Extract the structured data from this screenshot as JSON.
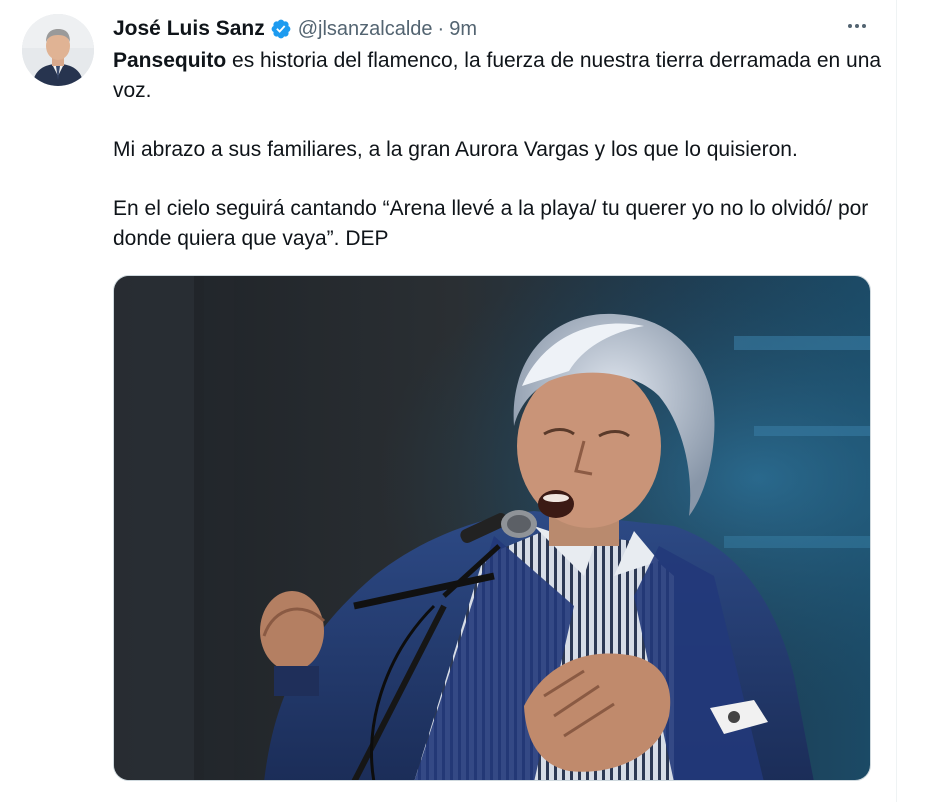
{
  "tweet": {
    "author_name": "José Luis Sanz",
    "handle": "@jlsanzalcalde",
    "separator": "·",
    "time": "9m",
    "verified": true,
    "more_icon": "ellipsis-icon",
    "text_bold": "Pansequito",
    "text_line1_rest": " es historia del flamenco, la fuerza de nuestra tierra derramada en una voz.",
    "text_paragraph2": "Mi abrazo a sus familiares, a la gran Aurora Vargas y los que lo quisieron.",
    "text_paragraph3": "En el cielo seguirá cantando “Arena llevé a la playa/ tu querer yo no lo olvidó/ por donde quiera que vaya”. DEP"
  },
  "colors": {
    "text": "#0f1419",
    "secondary": "#536471",
    "verified_blue": "#1d9bf0",
    "border": "#eff3f4"
  }
}
